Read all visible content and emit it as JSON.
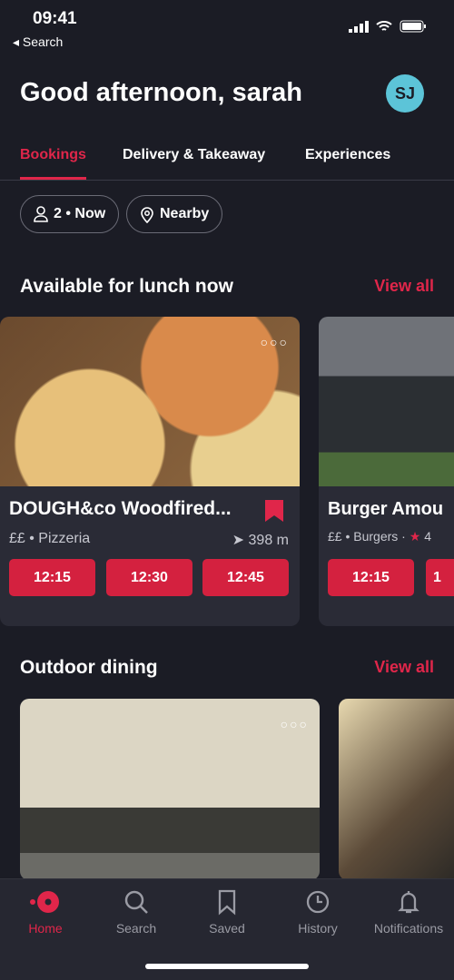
{
  "status": {
    "time": "09:41",
    "back": "Search"
  },
  "header": {
    "greeting": "Good afternoon, sarah",
    "avatar": "SJ"
  },
  "tabs": [
    {
      "label": "Bookings",
      "active": true
    },
    {
      "label": "Delivery & Takeaway"
    },
    {
      "label": "Experiences"
    }
  ],
  "filters": {
    "party": "2 • Now",
    "location": "Nearby"
  },
  "sections": [
    {
      "title": "Available for lunch now",
      "view_all": "View all"
    },
    {
      "title": "Outdoor dining",
      "view_all": "View all"
    }
  ],
  "lunch_cards": [
    {
      "name": "DOUGH&co Woodfired...",
      "price": "££",
      "cuisine": "Pizzeria",
      "distance": "398 m",
      "saved": true,
      "slots": [
        "12:15",
        "12:30",
        "12:45"
      ]
    },
    {
      "name": "Burger Amou",
      "price": "££",
      "cuisine": "Burgers",
      "rating": "4",
      "slots": [
        "12:15",
        "1"
      ]
    }
  ],
  "nav": [
    {
      "label": "Home",
      "icon": "home-icon",
      "active": true
    },
    {
      "label": "Search",
      "icon": "search-icon"
    },
    {
      "label": "Saved",
      "icon": "bookmark-icon"
    },
    {
      "label": "History",
      "icon": "clock-icon"
    },
    {
      "label": "Notifications",
      "icon": "bell-icon"
    }
  ],
  "colors": {
    "accent": "#e0264a",
    "background": "#1b1c25",
    "card": "#2a2b36",
    "avatar": "#5cc4d8"
  }
}
